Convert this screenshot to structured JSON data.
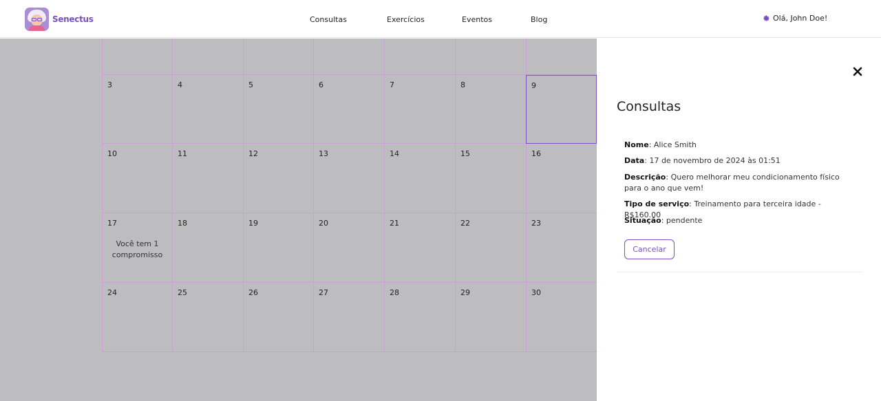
{
  "header": {
    "logo_text": "Senectus",
    "nav": [
      "Consultas",
      "Exercícios",
      "Eventos",
      "Blog"
    ],
    "user_greeting": "Olá, John Doe!"
  },
  "calendar": {
    "weeks": [
      [
        "",
        "",
        "",
        "",
        "",
        "",
        ""
      ],
      [
        "3",
        "4",
        "5",
        "6",
        "7",
        "8",
        "9"
      ],
      [
        "10",
        "11",
        "12",
        "13",
        "14",
        "15",
        "16"
      ],
      [
        "17",
        "18",
        "19",
        "20",
        "21",
        "22",
        "23"
      ],
      [
        "24",
        "25",
        "26",
        "27",
        "28",
        "29",
        "30"
      ]
    ],
    "selected_day": "9",
    "event_day": "17",
    "event_text": "Você tem 1 compromisso"
  },
  "drawer": {
    "title": "Consultas",
    "name_label": "Nome",
    "name_value": "Alice Smith",
    "date_label": "Data",
    "date_value": "17 de novembro de 2024 às 01:51",
    "desc_label": "Descrição",
    "desc_value": "Quero melhorar meu condicionamento físico para o ano que vem!",
    "service_label": "Tipo de serviço",
    "service_value": "Treinamento para terceira idade - R$160.00",
    "status_label": "Situação",
    "status_value": "pendente",
    "cancel_label": "Cancelar"
  },
  "colors": {
    "accent": "#7a4fc0",
    "grid_line": "#c7a4d1",
    "backdrop": "#bdbcbe"
  }
}
